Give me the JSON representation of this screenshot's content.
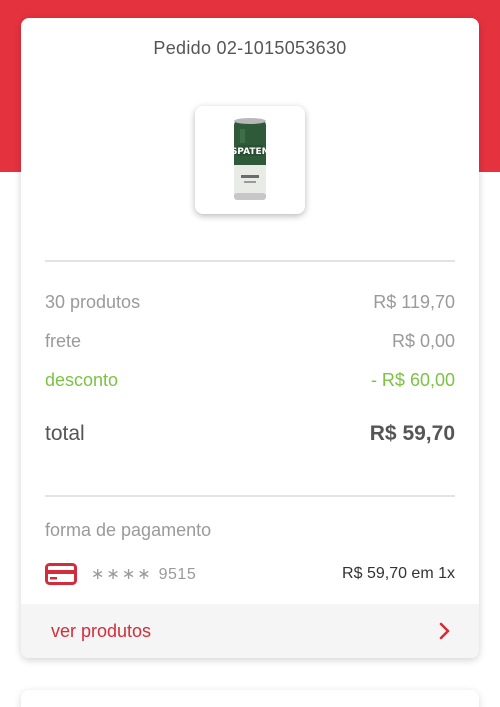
{
  "order": {
    "title": "Pedido 02-1015053630",
    "product_image": "beer-can-image"
  },
  "summary": {
    "products_label": "30 produtos",
    "products_value": "R$ 119,70",
    "shipping_label": "frete",
    "shipping_value": "R$ 0,00",
    "discount_label": "desconto",
    "discount_value": "- R$ 60,00",
    "total_label": "total",
    "total_value": "R$ 59,70"
  },
  "payment": {
    "section_label": "forma de pagamento",
    "card_icon": "credit-card-icon",
    "masked_stars": "∗∗∗∗",
    "card_last_digits": "9515",
    "amount": "R$ 59,70 em 1x"
  },
  "footer": {
    "link_label": "ver produtos",
    "chevron_icon": "chevron-right-icon"
  },
  "colors": {
    "brand_red": "#e5323f",
    "link_red": "#d22d3a",
    "discount_green": "#7cc243"
  }
}
